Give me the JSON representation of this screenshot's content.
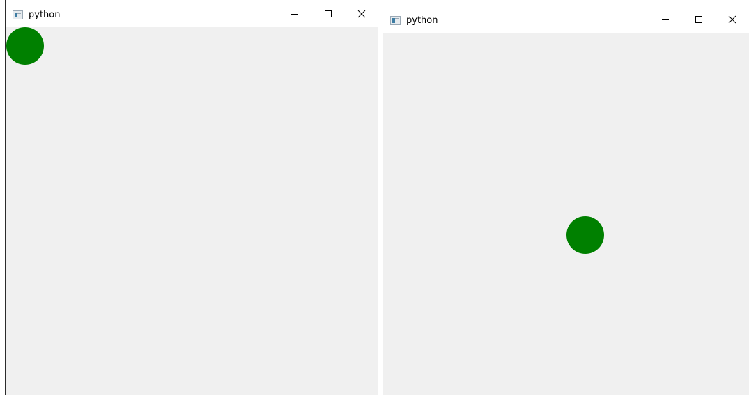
{
  "windows": [
    {
      "title": "python",
      "icon": "python-app-icon",
      "controls": [
        "minimize-icon",
        "maximize-icon",
        "close-icon"
      ],
      "ball_color": "#008000"
    },
    {
      "title": "python",
      "icon": "python-app-icon",
      "controls": [
        "minimize-icon",
        "maximize-icon",
        "close-icon"
      ],
      "ball_color": "#008000"
    }
  ],
  "colors": {
    "titlebar": "#ffffff",
    "client_background": "#f0f0f0",
    "ball": "#008000"
  }
}
